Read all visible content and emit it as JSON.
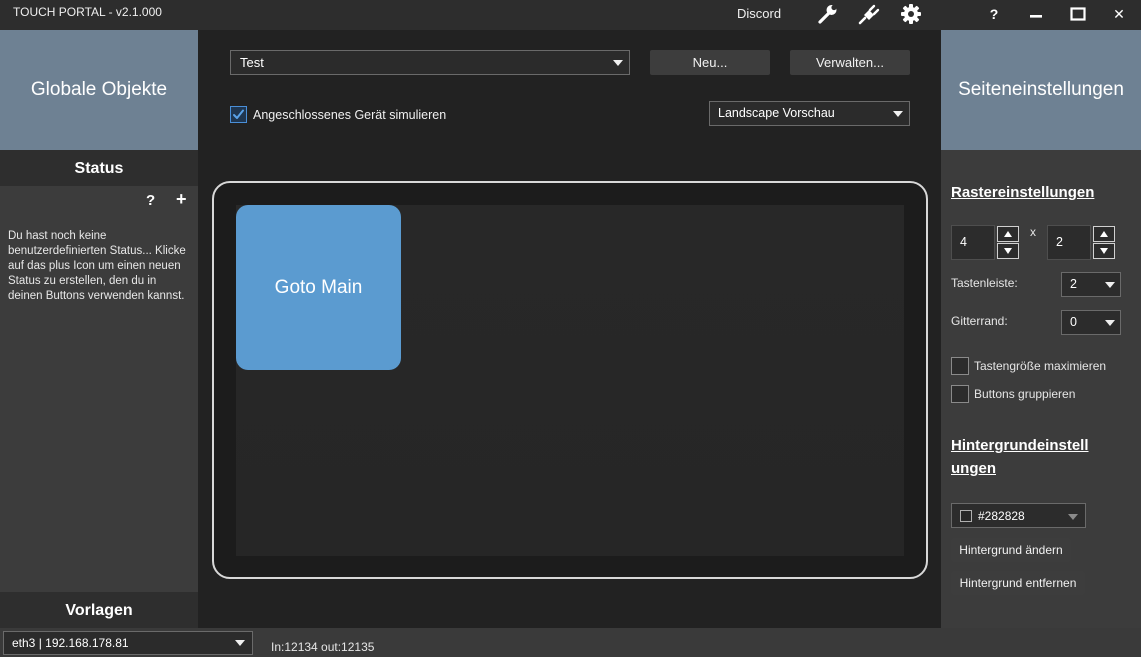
{
  "titlebar": {
    "title": "TOUCH PORTAL - v2.1.000",
    "discord_label": "Discord",
    "icons": [
      "wrench-icon",
      "plug-icon",
      "gear-icon"
    ],
    "help_label": "?",
    "close_label": "✕"
  },
  "left": {
    "global_objects_label": "Globale Objekte",
    "status_title": "Status",
    "status_help": "?",
    "status_add": "+",
    "status_empty_text": "Du hast noch keine benutzerdefinierten Status... Klicke auf das plus Icon um einen neuen Status zu erstellen, den du in deinen Buttons verwenden kannst.",
    "templates_title": "Vorlagen"
  },
  "center": {
    "page_select_value": "Test",
    "new_button": "Neu...",
    "manage_button": "Verwalten...",
    "simulate_label": "Angeschlossenes Gerät simulieren",
    "simulate_checked": true,
    "preview_select_value": "Landscape Vorschau",
    "tiles": [
      {
        "label": "Goto Main",
        "color": "#5b9bd0"
      }
    ]
  },
  "right": {
    "page_settings_label": "Seiteneinstellungen",
    "grid_settings_title": "Rastereinstellungen",
    "grid_cols": "4",
    "grid_x": "x",
    "grid_rows": "2",
    "button_bar_label": "Tastenleiste:",
    "button_bar_value": "2",
    "grid_border_label": "Gitterrand:",
    "grid_border_value": "0",
    "maximize_label": "Tastengröße maximieren",
    "group_label": "Buttons gruppieren",
    "background_title": "Hintergrundeinstellungen",
    "background_title_line1": "Hintergrundeinstell",
    "background_title_line2": "ungen",
    "background_color": "#282828",
    "change_bg_button": "Hintergrund ändern",
    "remove_bg_button": "Hintergrund entfernen"
  },
  "bottom": {
    "network_select_value": "eth3 | 192.168.178.81",
    "traffic_text": "In:12134 out:12135"
  },
  "colors": {
    "accent_panel": "#6e8193",
    "tile": "#5b9bd0",
    "background": "#222222"
  }
}
